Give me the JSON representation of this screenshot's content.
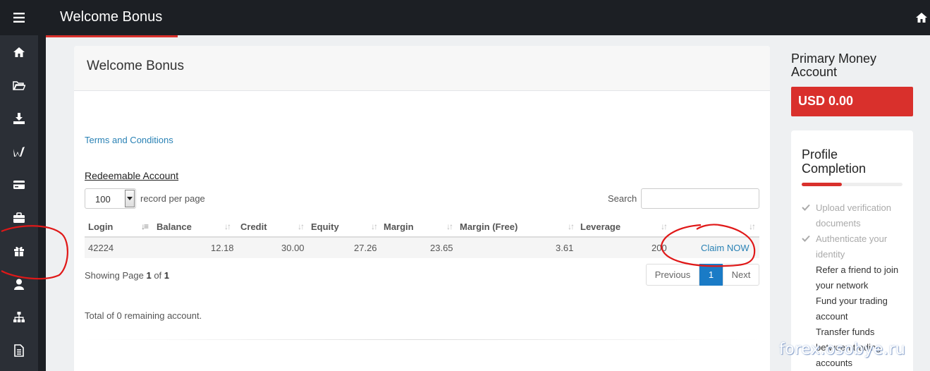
{
  "header": {
    "title": "Welcome Bonus"
  },
  "sidebar": {
    "items": [
      {
        "icon": "home-icon"
      },
      {
        "icon": "folder-open-icon"
      },
      {
        "icon": "download-icon"
      },
      {
        "icon": "logo-w-icon"
      },
      {
        "icon": "credit-card-icon"
      },
      {
        "icon": "briefcase-icon"
      },
      {
        "icon": "gift-icon"
      },
      {
        "icon": "user-icon"
      },
      {
        "icon": "sitemap-icon"
      },
      {
        "icon": "document-icon"
      }
    ]
  },
  "main": {
    "card_title": "Welcome Bonus",
    "terms_link": "Terms and Conditions",
    "section_label": "Redeemable Account",
    "per_page_value": "100",
    "per_page_label": "record per page",
    "search_label": "Search",
    "table": {
      "columns": [
        "Login",
        "Balance",
        "Credit",
        "Equity",
        "Margin",
        "Margin (Free)",
        "Leverage",
        ""
      ],
      "rows": [
        {
          "login": "42224",
          "balance": "12.18",
          "credit": "30.00",
          "equity": "27.26",
          "margin": "23.65",
          "margin_free": "3.61",
          "leverage": "200",
          "action": "Claim NOW"
        }
      ]
    },
    "showing": {
      "prefix": "Showing Page",
      "page": "1",
      "of": "of",
      "total": "1"
    },
    "pager": {
      "previous": "Previous",
      "current": "1",
      "next": "Next"
    },
    "total_text": "Total of 0 remaining account."
  },
  "right": {
    "account_title": "Primary Money Account",
    "balance": "USD 0.00",
    "profile_title": "Profile Completion",
    "progress": 0.4,
    "steps": [
      {
        "label": "Upload verification documents",
        "done": true
      },
      {
        "label": "Authenticate your identity",
        "done": true
      },
      {
        "label": "Refer a friend to join your network",
        "done": false
      },
      {
        "label": "Fund your trading account",
        "done": false
      },
      {
        "label": "Transfer funds between trading accounts",
        "done": false
      }
    ]
  },
  "watermark": "forex.osobye.ru",
  "colors": {
    "accent": "#d9302c",
    "link": "#2a82b5",
    "sidebar": "#2b2f36",
    "topbar": "#1c1f24",
    "pager_active": "#1a7bc6"
  }
}
